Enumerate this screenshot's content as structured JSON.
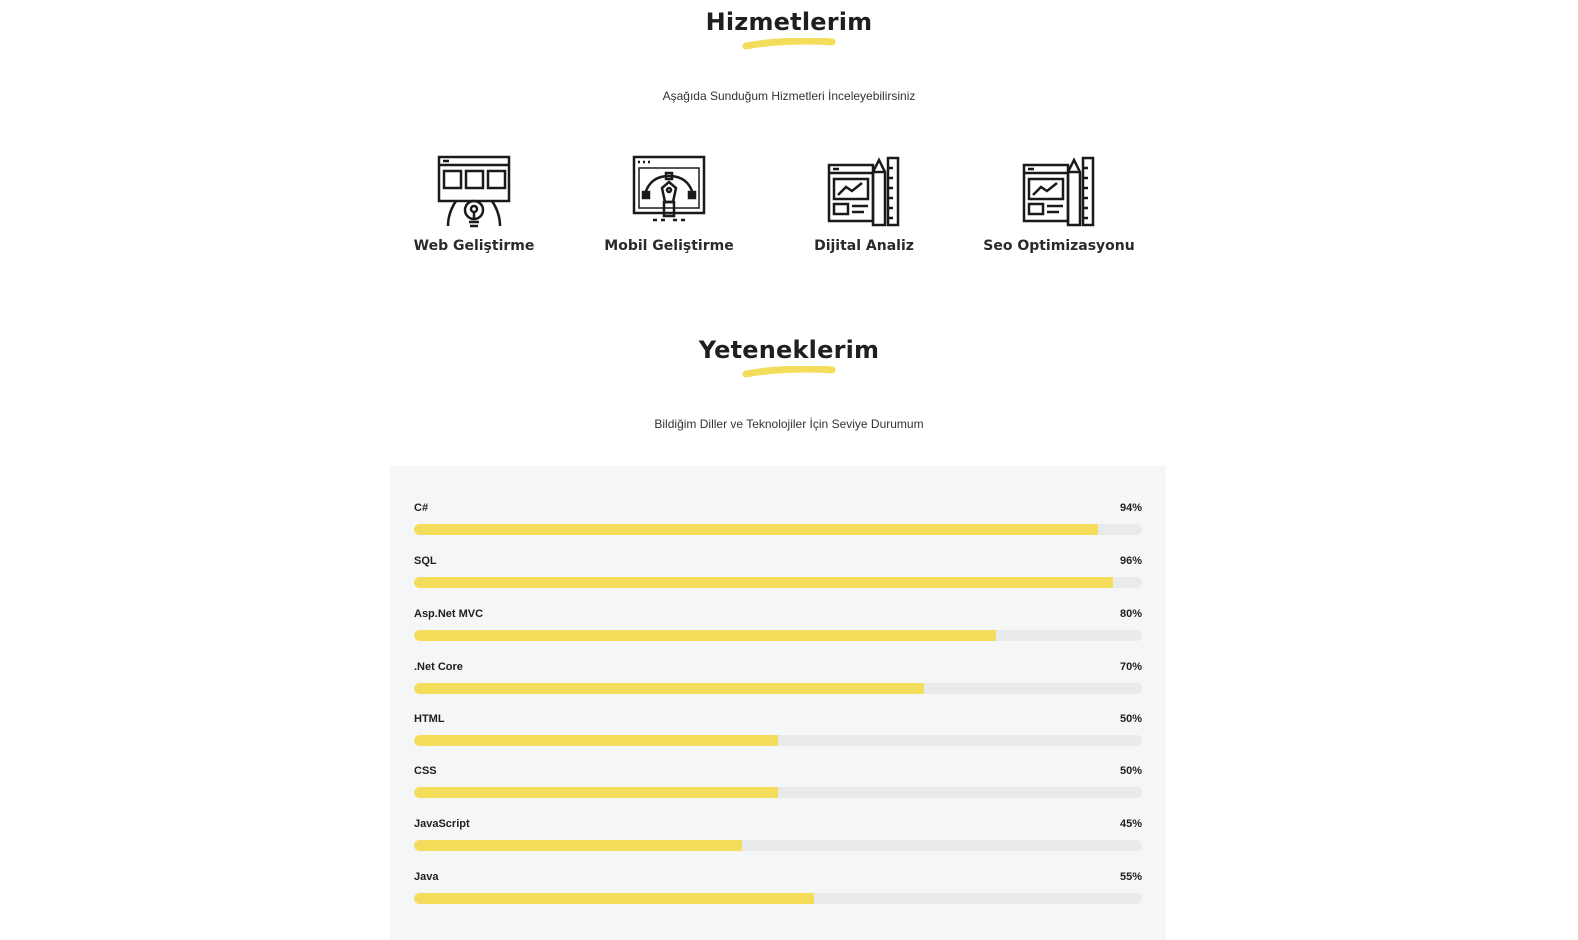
{
  "colors": {
    "accent": "#f5dd5c",
    "track": "#e9eaeb",
    "panel": "#f5f6f7",
    "text": "#1f1f1f"
  },
  "services": {
    "title": "Hizmetlerim",
    "subtitle": "Aşağıda Sunduğum Hizmetleri İnceleyebilirsiniz",
    "items": [
      {
        "label": "Web Geliştirme",
        "icon": "web-development-icon"
      },
      {
        "label": "Mobil Geliştirme",
        "icon": "mobile-design-icon"
      },
      {
        "label": "Dijital Analiz",
        "icon": "digital-analysis-icon"
      },
      {
        "label": "Seo Optimizasyonu",
        "icon": "seo-optimization-icon"
      }
    ]
  },
  "skills": {
    "title": "Yeteneklerim",
    "subtitle": "Bildiğim Diller ve Teknolojiler İçin Seviye Durumum",
    "items": [
      {
        "name": "C#",
        "percent_label": "94%",
        "level": 94
      },
      {
        "name": "SQL",
        "percent_label": "96%",
        "level": 96
      },
      {
        "name": "Asp.Net MVC",
        "percent_label": "80%",
        "level": 80
      },
      {
        "name": ".Net Core",
        "percent_label": "70%",
        "level": 70
      },
      {
        "name": "HTML",
        "percent_label": "50%",
        "level": 50
      },
      {
        "name": "CSS",
        "percent_label": "50%",
        "level": 50
      },
      {
        "name": "JavaScript",
        "percent_label": "45%",
        "level": 45
      },
      {
        "name": "Java",
        "percent_label": "55%",
        "level": 55
      }
    ]
  }
}
